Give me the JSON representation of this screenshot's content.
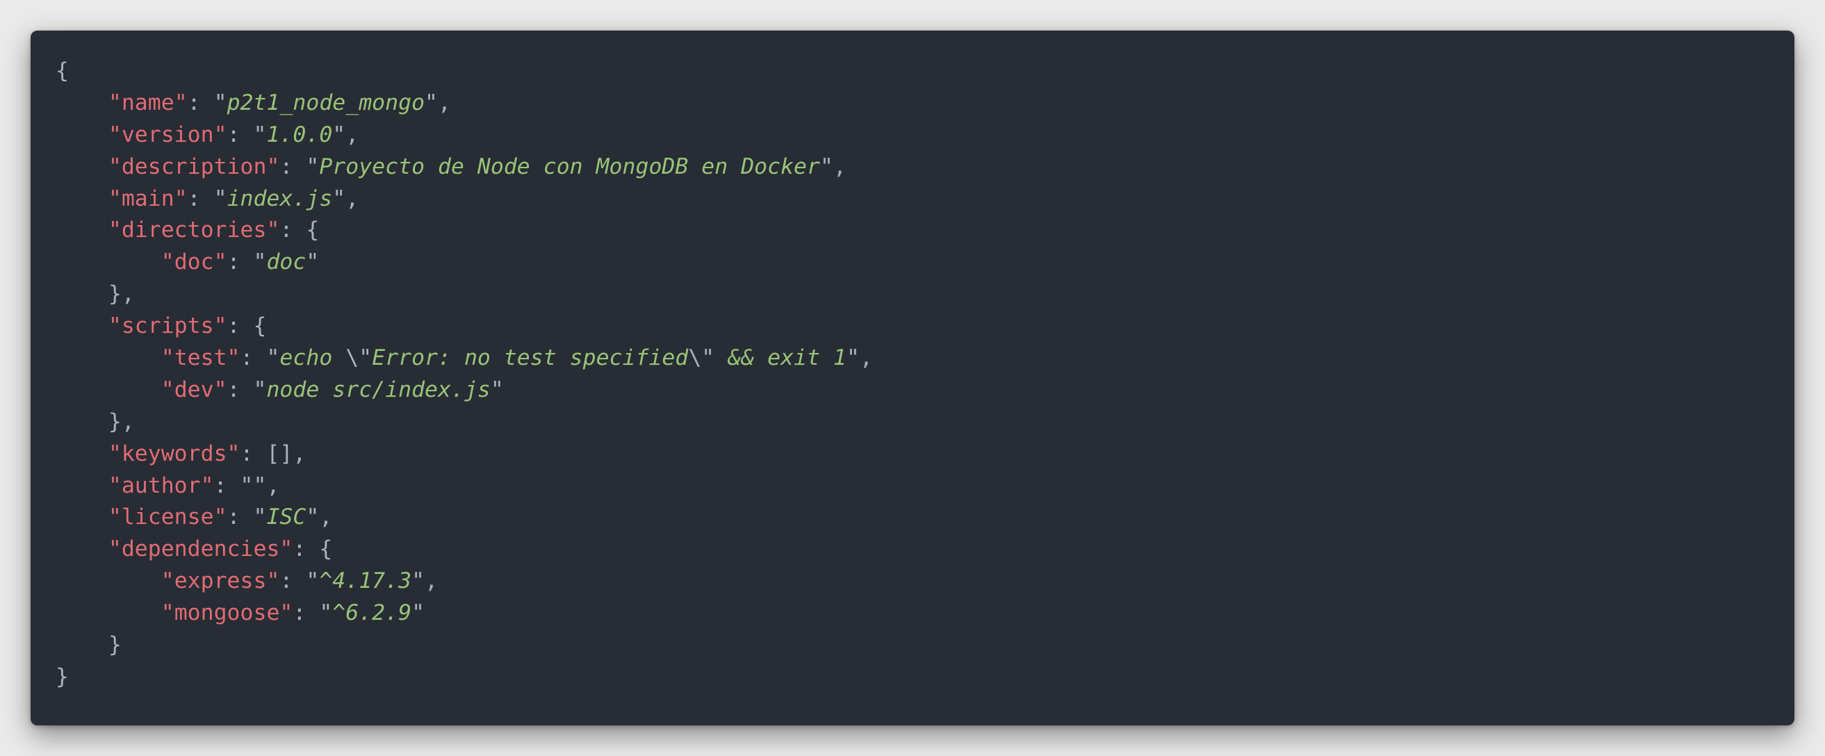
{
  "code": {
    "open_brace": "{",
    "close_brace": "}",
    "name_key": "name",
    "name_value": "p2t1_node_mongo",
    "version_key": "version",
    "version_value": "1.0.0",
    "description_key": "description",
    "description_value": "Proyecto de Node con MongoDB en Docker",
    "main_key": "main",
    "main_value": "index.js",
    "directories_key": "directories",
    "doc_key": "doc",
    "doc_value": "doc",
    "scripts_key": "scripts",
    "test_key": "test",
    "test_value_pre": "echo ",
    "test_value_esc1": "\\\"",
    "test_value_mid": "Error: no test specified",
    "test_value_esc2": "\\\"",
    "test_value_post": " && exit 1",
    "dev_key": "dev",
    "dev_value": "node src/index.js",
    "keywords_key": "keywords",
    "keywords_value": "[]",
    "author_key": "author",
    "author_value": "",
    "license_key": "license",
    "license_value": "ISC",
    "dependencies_key": "dependencies",
    "express_key": "express",
    "express_value": "^4.17.3",
    "mongoose_key": "mongoose",
    "mongoose_value": "^6.2.9"
  },
  "colors": {
    "background": "#282c34",
    "key": "#e06c75",
    "string": "#98c379",
    "punctuation": "#abb2bf"
  }
}
